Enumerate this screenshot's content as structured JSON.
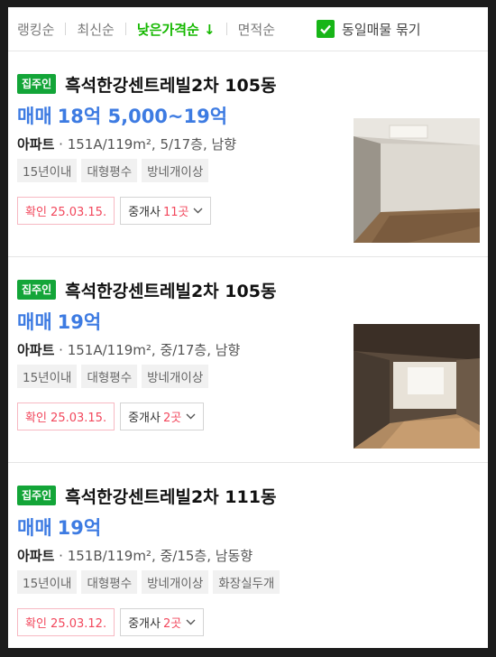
{
  "sort": {
    "options": [
      "랭킹순",
      "최신순",
      "낮은가격순 ↓",
      "면적순"
    ],
    "active_index": 2,
    "group_label": "동일매물 묶기",
    "group_checked": true
  },
  "listings": [
    {
      "badge": "집주인",
      "name": "흑석한강센트레빌2차 105동",
      "trade": "매매",
      "price": "18억 5,000~19억",
      "ptype": "아파트",
      "detail": "151A/119m², 5/17층, 남향",
      "tags": [
        "15년이내",
        "대형평수",
        "방네개이상"
      ],
      "confirm": "확인 25.03.15.",
      "agent_label": "중개사",
      "agent_count": "11곳"
    },
    {
      "badge": "집주인",
      "name": "흑석한강센트레빌2차 105동",
      "trade": "매매",
      "price": "19억",
      "ptype": "아파트",
      "detail": "151A/119m², 중/17층, 남향",
      "tags": [
        "15년이내",
        "대형평수",
        "방네개이상"
      ],
      "confirm": "확인 25.03.15.",
      "agent_label": "중개사",
      "agent_count": "2곳"
    },
    {
      "badge": "집주인",
      "name": "흑석한강센트레빌2차 111동",
      "trade": "매매",
      "price": "19억",
      "ptype": "아파트",
      "detail": "151B/119m², 중/15층, 남동향",
      "tags": [
        "15년이내",
        "대형평수",
        "방네개이상",
        "화장실두개"
      ],
      "confirm": "확인 25.03.12.",
      "agent_label": "중개사",
      "agent_count": "2곳"
    }
  ],
  "colors": {
    "accent_green": "#15b800",
    "price_blue": "#3d7be2",
    "confirm_red": "#f2475c",
    "badge_green": "#13a538"
  }
}
